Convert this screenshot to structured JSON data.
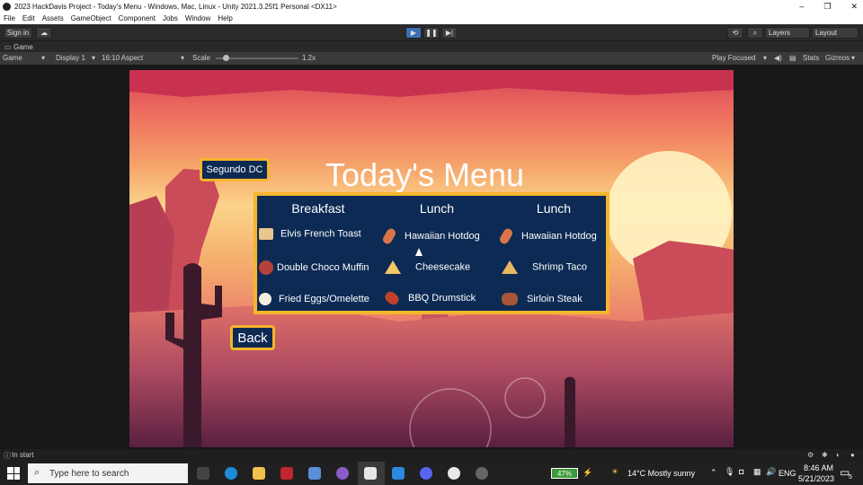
{
  "window": {
    "title": "2023 HackDavis Project - Today's Menu - Windows, Mac, Linux - Unity 2021.3.25f1 Personal <DX11>",
    "controls": [
      "–",
      "❐",
      "✕"
    ]
  },
  "menu": [
    "File",
    "Edit",
    "Assets",
    "GameObject",
    "Component",
    "Jobs",
    "Window",
    "Help"
  ],
  "toolbar": {
    "sign_in": "Sign in",
    "layers": "Layers",
    "layout": "Layout"
  },
  "tab": {
    "label": "Game"
  },
  "gamebar": {
    "mode": "Game",
    "display": "Display 1",
    "aspect": "16:10 Aspect",
    "scale_label": "Scale",
    "scale_value": "1.2x",
    "play_focused": "Play Focused",
    "stats": "Stats",
    "gizmos": "Gizmos"
  },
  "game": {
    "title": "Today's Menu",
    "location_button": "Segundo DC",
    "back_button": "Back",
    "columns": [
      {
        "heading": "Breakfast",
        "items": [
          "Elvis French Toast",
          "Double Choco Muffin",
          "Fried Eggs/Omelette"
        ]
      },
      {
        "heading": "Lunch",
        "items": [
          "Hawaiian Hotdog",
          "Cheesecake",
          "BBQ Drumstick"
        ]
      },
      {
        "heading": "Lunch",
        "items": [
          "Hawaiian Hotdog",
          "Shrimp Taco",
          "Sirloin Steak"
        ]
      }
    ]
  },
  "status": {
    "text": "In start"
  },
  "taskbar": {
    "search_placeholder": "Type here to search",
    "battery": "47%",
    "weather": "14°C  Mostly sunny",
    "lang": "ENG",
    "time": "8:46 AM",
    "date": "5/21/2023",
    "notifications": "5"
  },
  "colors": {
    "accent": "#f5b52c",
    "panel": "#0c2a54",
    "play_active": "#3d6fb5"
  }
}
